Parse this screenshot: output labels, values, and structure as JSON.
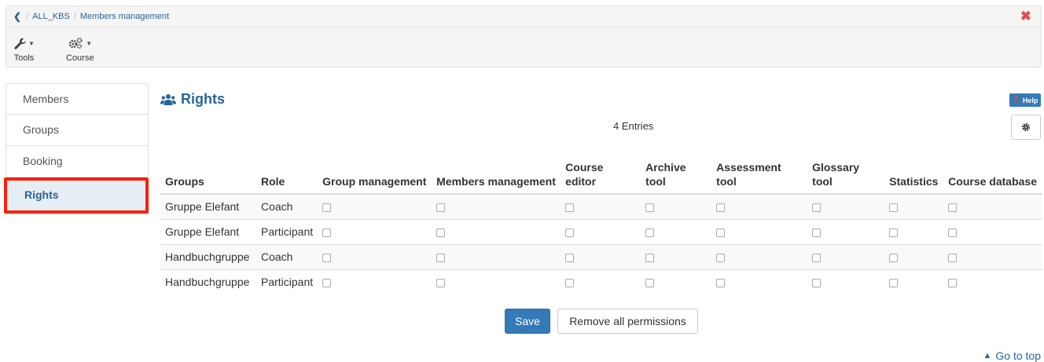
{
  "breadcrumb": {
    "back_icon": "chevron-left-icon",
    "items": [
      "ALL_KBS",
      "Members management"
    ],
    "separator": "/"
  },
  "close_icon": "close-icon",
  "toolbar": {
    "tools_label": "Tools",
    "course_label": "Course"
  },
  "sidebar": {
    "items": [
      {
        "label": "Members"
      },
      {
        "label": "Groups"
      },
      {
        "label": "Booking"
      },
      {
        "label": "Rights",
        "active": true
      }
    ]
  },
  "main": {
    "title": "Rights",
    "help_label": "Help",
    "entries_text": "4 Entries",
    "columns": [
      "Groups",
      "Role",
      "Group management",
      "Members management",
      "Course editor",
      "Archive tool",
      "Assessment tool",
      "Glossary tool",
      "Statistics",
      "Course database"
    ],
    "rows": [
      {
        "group": "Gruppe Elefant",
        "role": "Coach"
      },
      {
        "group": "Gruppe Elefant",
        "role": "Participant"
      },
      {
        "group": "Handbuchgruppe",
        "role": "Coach"
      },
      {
        "group": "Handbuchgruppe",
        "role": "Participant"
      }
    ],
    "save_label": "Save",
    "remove_label": "Remove all permissions",
    "go_to_top_label": "Go to top"
  },
  "colors": {
    "accent": "#337ab7",
    "link": "#2a6496",
    "highlight": "#fb1f0a",
    "close": "#d9534f"
  }
}
